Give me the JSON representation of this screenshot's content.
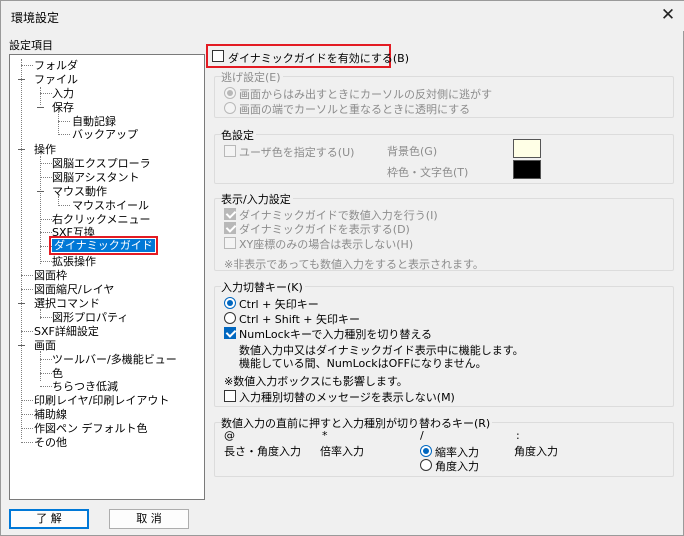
{
  "window": {
    "title": "環境設定",
    "close_glyph": "✕"
  },
  "tree": {
    "header": "設定項目",
    "items": [
      "フォルダ",
      "ファイル",
      "入力",
      "保存",
      "自動記録",
      "バックアップ",
      "操作",
      "図脳エクスプローラ",
      "図脳アシスタント",
      "マウス動作",
      "マウスホイール",
      "右クリックメニュー",
      "SXF互換",
      "ダイナミックガイド",
      "拡張操作",
      "図面枠",
      "図面縮尺/レイヤ",
      "選択コマンド",
      "図形プロパティ",
      "SXF詳細設定",
      "画面",
      "ツールバー/多機能ビュー",
      "色",
      "ちらつき低減",
      "印刷レイヤ/印刷レイアウト",
      "補助線",
      "作図ペン デフォルト色",
      "その他"
    ]
  },
  "buttons": {
    "ok": "了 解",
    "cancel": "取 消"
  },
  "enable": {
    "label": "ダイナミックガイドを有効にする(B)",
    "checked": false
  },
  "escape": {
    "title": "逃げ設定(E)",
    "options": [
      "画面からはみ出すときにカーソルの反対側に逃がす",
      "画面の端でカーソルと重なるときに透明にする"
    ],
    "selected_index": 0
  },
  "color": {
    "title": "色設定",
    "user_color_label": "ユーザ色を指定する(U)",
    "bg_label": "背景色(G)",
    "frame_label": "枠色・文字色(T)",
    "bg_color": "#ffffe6",
    "frame_color": "#000000"
  },
  "display": {
    "title": "表示/入力設定",
    "options": [
      {
        "label": "ダイナミックガイドで数値入力を行う(I)",
        "checked": true
      },
      {
        "label": "ダイナミックガイドを表示する(D)",
        "checked": true
      },
      {
        "label": "XY座標のみの場合は表示しない(H)",
        "checked": false
      }
    ],
    "note": "※非表示であっても数値入力をすると表示されます。"
  },
  "switch_key": {
    "title": "入力切替キー(K)",
    "radios": [
      "Ctrl + 矢印キー",
      "Ctrl + Shift + 矢印キー"
    ],
    "selected_index": 0,
    "numlock_label": "NumLockキーで入力種別を切り替える",
    "numlock_checked": true,
    "numlock_desc1": "数値入力中又はダイナミックガイド表示中に機能します。",
    "numlock_desc2": "機能している間、NumLockはOFFになりません。",
    "note": "※数値入力ボックスにも影響します。",
    "hide_msg_label": "入力種別切替のメッセージを表示しない(M)",
    "hide_msg_checked": false
  },
  "prefix_key": {
    "title": "数値入力の直前に押すと入力種別が切り替わるキー(R)",
    "cols": [
      {
        "key": "@",
        "label": "長さ・角度入力"
      },
      {
        "key": "*",
        "label": "倍率入力"
      },
      {
        "key": "/",
        "radios": [
          "縮率入力",
          "角度入力"
        ],
        "selected_index": 0
      },
      {
        "key": ":",
        "label": "角度入力"
      }
    ]
  }
}
